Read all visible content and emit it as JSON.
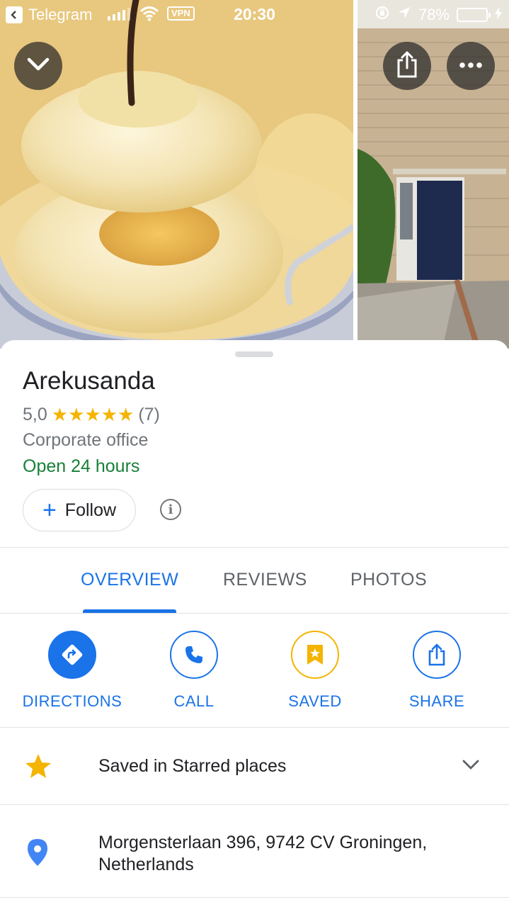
{
  "status_bar": {
    "back_app": "Telegram",
    "vpn": "VPN",
    "time": "20:30",
    "battery": "78%",
    "battery_level": 0.78,
    "battery_color": "#f6c026"
  },
  "header_buttons": {
    "collapse_icon": "chevron-down-icon",
    "share_icon": "share-icon",
    "more_icon": "more-horiz-icon"
  },
  "place": {
    "name": "Arekusanda",
    "rating": "5,0",
    "stars": "★★★★★",
    "review_count": "(7)",
    "category": "Corporate office",
    "hours": "Open 24 hours"
  },
  "follow": {
    "label": "Follow",
    "icon": "plus-icon"
  },
  "info_icon": "info-icon",
  "tabs": [
    {
      "label": "OVERVIEW",
      "active": true
    },
    {
      "label": "REVIEWS",
      "active": false
    },
    {
      "label": "PHOTOS",
      "active": false
    }
  ],
  "actions": [
    {
      "label": "DIRECTIONS",
      "icon": "directions-icon"
    },
    {
      "label": "CALL",
      "icon": "phone-icon"
    },
    {
      "label": "SAVED",
      "icon": "bookmark-star-icon"
    },
    {
      "label": "SHARE",
      "icon": "share-icon"
    }
  ],
  "saved_row": {
    "text": "Saved in Starred places",
    "icon": "star-icon",
    "expand_icon": "chevron-down-icon"
  },
  "address_row": {
    "line1": "Morgensterlaan 396, 9742 CV Groningen,",
    "line2": "Netherlands",
    "icon": "location-pin-icon"
  },
  "colors": {
    "accent": "#1a73e8",
    "open_green": "#188038",
    "star_yellow": "#f4b400",
    "secondary_text": "#70757a"
  }
}
